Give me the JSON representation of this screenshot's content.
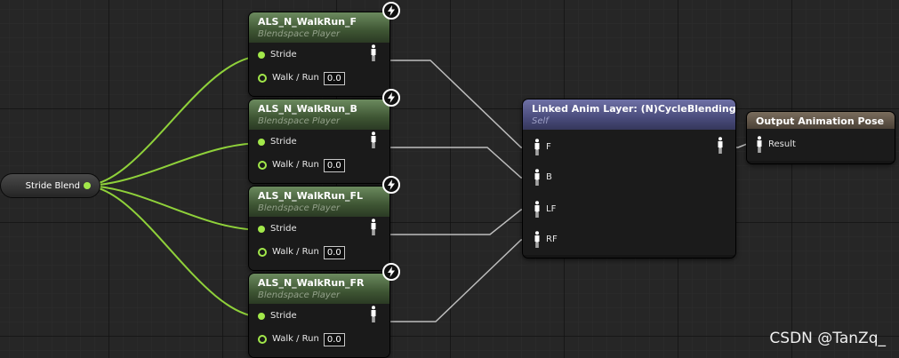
{
  "reroute": {
    "label": "Stride Blend"
  },
  "blendspaces": [
    {
      "title": "ALS_N_WalkRun_F",
      "subtitle": "Blendspace Player",
      "stride_label": "Stride",
      "walkrun_label": "Walk / Run",
      "walkrun_value": "0.0"
    },
    {
      "title": "ALS_N_WalkRun_B",
      "subtitle": "Blendspace Player",
      "stride_label": "Stride",
      "walkrun_label": "Walk / Run",
      "walkrun_value": "0.0"
    },
    {
      "title": "ALS_N_WalkRun_FL",
      "subtitle": "Blendspace Player",
      "stride_label": "Stride",
      "walkrun_label": "Walk / Run",
      "walkrun_value": "0.0"
    },
    {
      "title": "ALS_N_WalkRun_FR",
      "subtitle": "Blendspace Player",
      "stride_label": "Stride",
      "walkrun_label": "Walk / Run",
      "walkrun_value": "0.0"
    }
  ],
  "linked_layer": {
    "title": "Linked Anim Layer: (N)CycleBlending",
    "subtitle": "Self",
    "pins": [
      "F",
      "B",
      "LF",
      "RF"
    ]
  },
  "output_pose": {
    "title": "Output Animation Pose",
    "pin": "Result"
  },
  "watermark": "CSDN @TanZq_",
  "colors": {
    "float_pin": "#a2e84a",
    "pose_wire": "#c8c8c8",
    "blendspace_header": "#4e6a42",
    "linked_header": "#5a5c90",
    "output_header": "#6a5e50",
    "background": "#262626"
  }
}
